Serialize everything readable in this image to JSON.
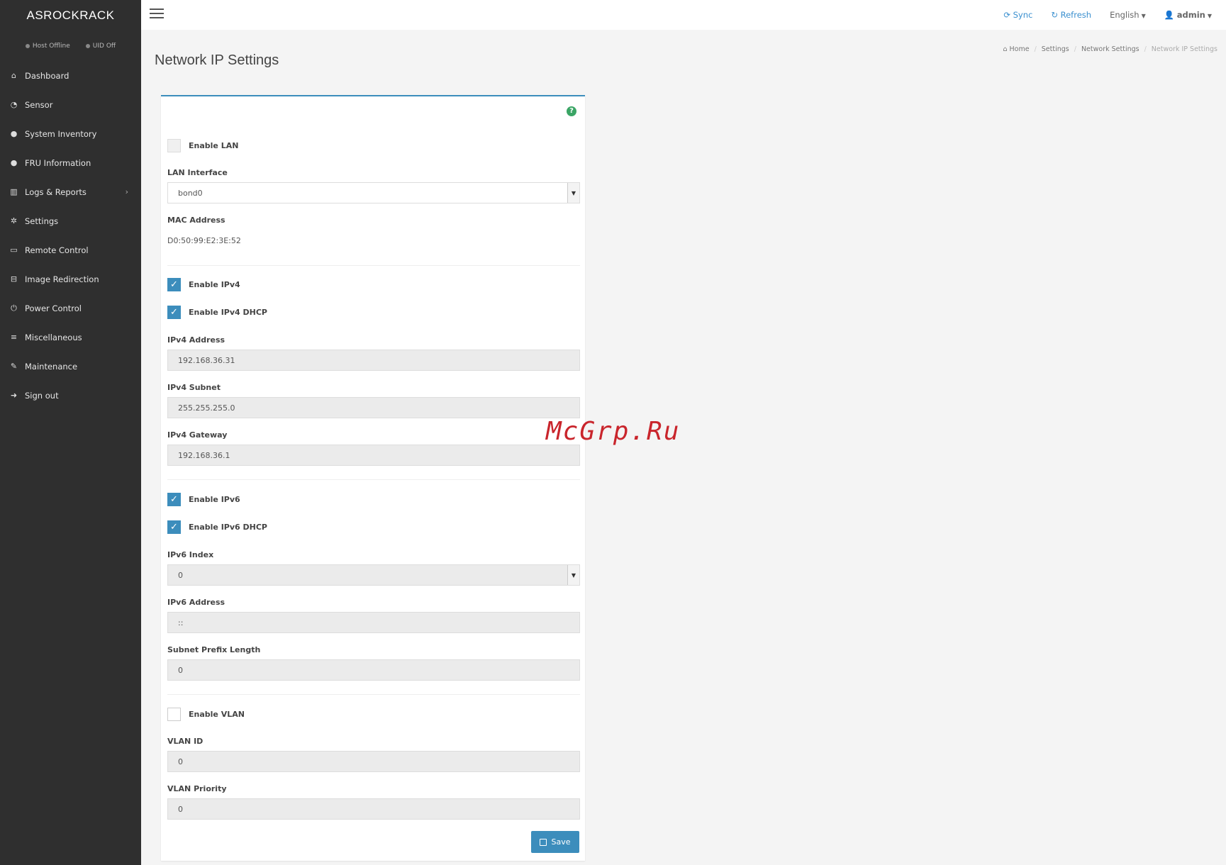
{
  "sidebar": {
    "brand": "ASROCKRACK",
    "status": [
      "Host Offline",
      "UID Off"
    ],
    "items": [
      {
        "label": "Dashboard",
        "icon": "home-icon"
      },
      {
        "label": "Sensor",
        "icon": "dashboard-icon"
      },
      {
        "label": "System Inventory",
        "icon": "info-icon"
      },
      {
        "label": "FRU Information",
        "icon": "info-icon"
      },
      {
        "label": "Logs & Reports",
        "icon": "chart-icon"
      },
      {
        "label": "Settings",
        "icon": "gear-icon"
      },
      {
        "label": "Remote Control",
        "icon": "monitor-icon"
      },
      {
        "label": "Image Redirection",
        "icon": "drive-icon"
      },
      {
        "label": "Power Control",
        "icon": "power-icon"
      },
      {
        "label": "Miscellaneous",
        "icon": "list-icon"
      },
      {
        "label": "Maintenance",
        "icon": "wrench-icon"
      },
      {
        "label": "Sign out",
        "icon": "signout-icon"
      }
    ],
    "logs_chevron": "›"
  },
  "topbar": {
    "sync": "Sync",
    "refresh": "Refresh",
    "language": "English",
    "user": "admin"
  },
  "page": {
    "title": "Network IP Settings",
    "breadcrumb": [
      "Home",
      "Settings",
      "Network Settings",
      "Network IP Settings"
    ]
  },
  "form": {
    "enable_lan": "Enable LAN",
    "lan_interface_label": "LAN Interface",
    "lan_interface_value": "bond0",
    "mac_label": "MAC Address",
    "mac_value": "D0:50:99:E2:3E:52",
    "enable_ipv4": "Enable IPv4",
    "enable_ipv4_dhcp": "Enable IPv4 DHCP",
    "ipv4_address_label": "IPv4 Address",
    "ipv4_address_value": "192.168.36.31",
    "ipv4_subnet_label": "IPv4 Subnet",
    "ipv4_subnet_value": "255.255.255.0",
    "ipv4_gateway_label": "IPv4 Gateway",
    "ipv4_gateway_value": "192.168.36.1",
    "enable_ipv6": "Enable IPv6",
    "enable_ipv6_dhcp": "Enable IPv6 DHCP",
    "ipv6_index_label": "IPv6 Index",
    "ipv6_index_value": "0",
    "ipv6_address_label": "IPv6 Address",
    "ipv6_address_value": "::",
    "prefix_label": "Subnet Prefix Length",
    "prefix_value": "0",
    "enable_vlan": "Enable VLAN",
    "vlan_id_label": "VLAN ID",
    "vlan_id_value": "0",
    "vlan_priority_label": "VLAN Priority",
    "vlan_priority_value": "0",
    "save": "Save"
  },
  "watermark": "McGrp.Ru",
  "colors": {
    "accent": "#3c8dbc",
    "sidebar": "#2f2f2f",
    "help": "#3aa565",
    "watermark": "#c9252c"
  }
}
